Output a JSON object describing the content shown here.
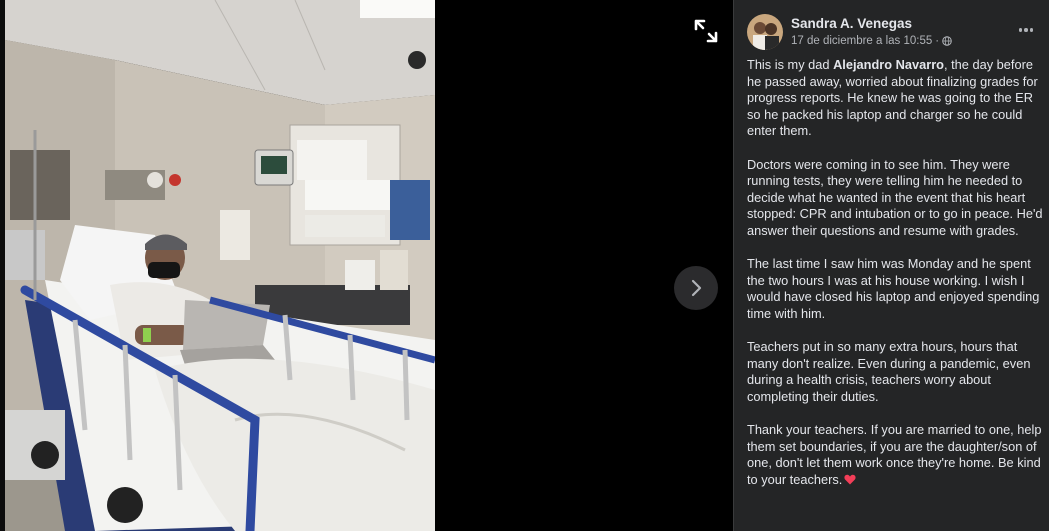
{
  "post": {
    "author_name": "Sandra A. Venegas",
    "timestamp": "17 de diciembre a las 10:55",
    "separator": "·",
    "audience_icon": "globe-icon",
    "more_icon": "more-options-icon",
    "paragraphs": [
      {
        "before": "This is my dad ",
        "bold": "Alejandro Navarro",
        "after": ", the day before he passed away, worried about finalizing grades for progress reports. He knew he was going to the ER so he packed his laptop and charger so he could enter them."
      },
      {
        "text": "Doctors were coming in to see him. They were running tests, they were telling him he needed to decide what he wanted in the event that his heart stopped: CPR and intubation or to go in peace. He'd answer their questions and resume with grades."
      },
      {
        "text": "The last time I saw him was Monday and he spent the two hours I was at his house working. I wish I would have closed his laptop and enjoyed spending time with him."
      },
      {
        "text": "Teachers put in so many extra hours, hours that many don't realize. Even during a pandemic, even during a health crisis, teachers worry about completing their duties."
      },
      {
        "text": "Thank your teachers. If you are married to one, help them set boundaries, if you are the daughter/son of one, don't let them work once they're home. Be kind to your teachers."
      }
    ],
    "trailing_emoji": "heart-icon"
  },
  "viewer": {
    "expand_icon": "expand-icon",
    "next_icon": "chevron-right-icon"
  },
  "colors": {
    "panel_bg": "#242526",
    "text_primary": "#e4e6eb",
    "text_secondary": "#b0b3b8",
    "heart": "#f33e58"
  }
}
